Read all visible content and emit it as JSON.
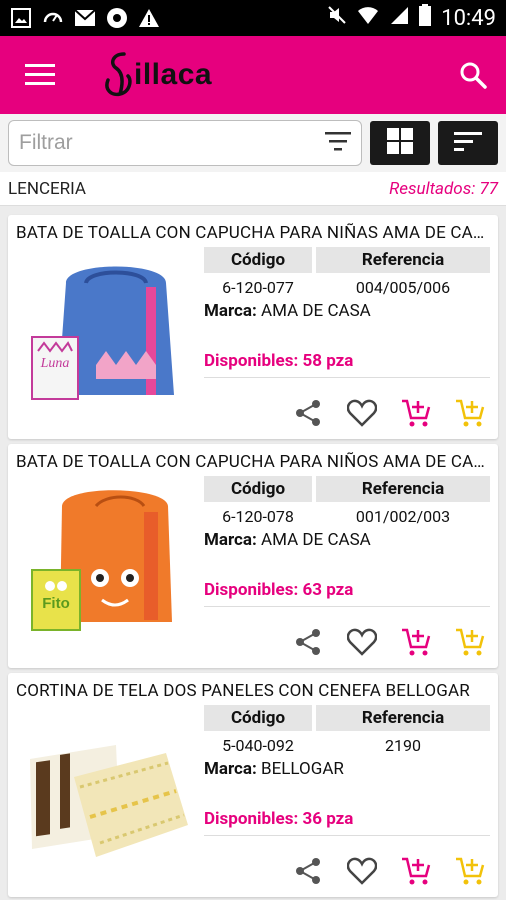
{
  "status": {
    "time": "10:49"
  },
  "app": {
    "brand": "illaca",
    "accent": "#e6007e"
  },
  "filter": {
    "placeholder": "Filtrar"
  },
  "section": {
    "title": "LENCERIA",
    "results": "Resultados: 77"
  },
  "labels": {
    "codigo": "Código",
    "referencia": "Referencia",
    "marca": "Marca:"
  },
  "products": [
    {
      "title": "BATA DE TOALLA CON CAPUCHA PARA NIÑAS AMA DE CASA",
      "codigo": "6-120-077",
      "referencia": "004/005/006",
      "marca": "AMA DE CASA",
      "disponibles": "Disponibles: 58 pza"
    },
    {
      "title": "BATA DE TOALLA CON CAPUCHA PARA NIÑOS AMA DE CASA",
      "codigo": "6-120-078",
      "referencia": "001/002/003",
      "marca": "AMA DE CASA",
      "disponibles": "Disponibles: 63 pza"
    },
    {
      "title": "CORTINA DE TELA DOS PANELES CON CENEFA BELLOGAR",
      "codigo": "5-040-092",
      "referencia": "2190",
      "marca": "BELLOGAR",
      "disponibles": "Disponibles: 36 pza"
    }
  ]
}
